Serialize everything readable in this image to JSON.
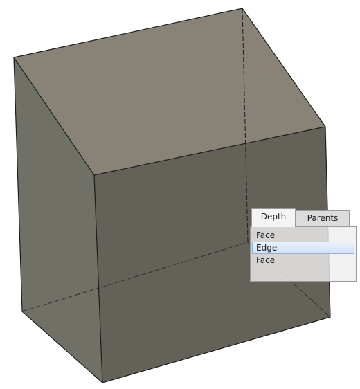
{
  "viewport": {
    "background": "#ffffff",
    "model": {
      "face_color": "#6c6a5e",
      "top_color": "#8a857a",
      "edge_color": "#1c1c1c",
      "hidden_edge_style": "dashed"
    }
  },
  "selection_picker": {
    "tabs": [
      {
        "label": "Depth",
        "active": true
      },
      {
        "label": "Parents",
        "active": false
      }
    ],
    "items": [
      {
        "label": "Face",
        "selected": false
      },
      {
        "label": "Edge",
        "selected": true
      },
      {
        "label": "Face",
        "selected": false
      }
    ],
    "highlight_color": "#8fb2df"
  }
}
